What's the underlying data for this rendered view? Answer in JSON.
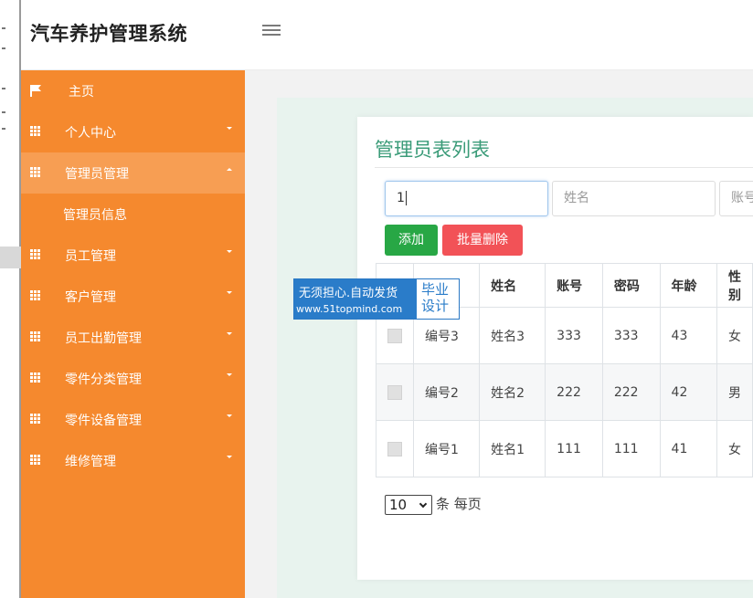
{
  "app": {
    "title": "汽车养护管理系统"
  },
  "sidebar": {
    "items": [
      {
        "label": "主页",
        "icon": "flag-icon"
      },
      {
        "label": "个人中心",
        "icon": "grid-icon"
      },
      {
        "label": "管理员管理",
        "icon": "grid-icon",
        "expanded": true
      },
      {
        "label": "员工管理",
        "icon": "grid-icon"
      },
      {
        "label": "客户管理",
        "icon": "grid-icon"
      },
      {
        "label": "员工出勤管理",
        "icon": "grid-icon"
      },
      {
        "label": "零件分类管理",
        "icon": "grid-icon"
      },
      {
        "label": "零件设备管理",
        "icon": "grid-icon"
      },
      {
        "label": "维修管理",
        "icon": "grid-icon"
      }
    ],
    "subitems": [
      {
        "label": "管理员信息"
      }
    ]
  },
  "main": {
    "title": "管理员表列表",
    "search": {
      "field1_value": "1",
      "field2_placeholder": "姓名",
      "field3_placeholder": "账号"
    },
    "buttons": {
      "add": "添加",
      "batch_delete": "批量删除"
    },
    "table": {
      "headers": [
        "",
        "",
        "姓名",
        "账号",
        "密码",
        "年龄",
        "性别"
      ],
      "rows": [
        [
          "编号3",
          "姓名3",
          "333",
          "333",
          "43",
          "女"
        ],
        [
          "编号2",
          "姓名2",
          "222",
          "222",
          "42",
          "男"
        ],
        [
          "编号1",
          "姓名1",
          "111",
          "111",
          "41",
          "女"
        ]
      ]
    },
    "pagination": {
      "page_size": "10",
      "suffix": "条 每页"
    }
  },
  "watermark": {
    "line1": "无须担心.自动发货",
    "line2": "www.51topmind.com",
    "badge_line1": "毕业",
    "badge_line2": "设计"
  },
  "colors": {
    "sidebar": "#f5892e",
    "sidebar_active": "#f79e53",
    "title": "#3a9b78",
    "add": "#28a745",
    "delete": "#f25257"
  }
}
